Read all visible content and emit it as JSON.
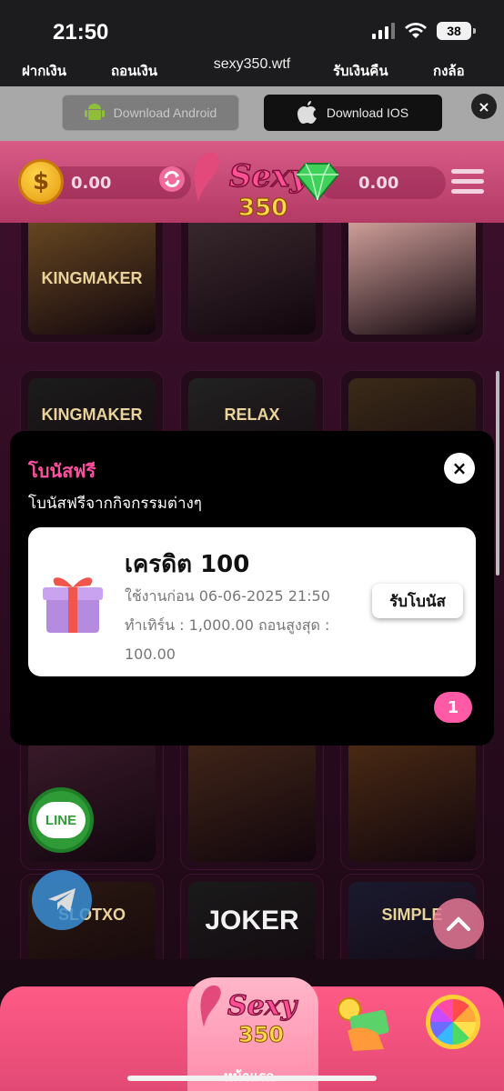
{
  "status_bar": {
    "time": "21:50",
    "battery": "38"
  },
  "browser": {
    "url": "sexy350.wtf"
  },
  "download_bar": {
    "android_label": "Download Android",
    "ios_label": "Download IOS",
    "close": "×"
  },
  "header": {
    "balance_left": "0.00",
    "balance_right": "0.00",
    "coin_symbol": "$",
    "logo_text": "Sexy",
    "logo_number": "350"
  },
  "games": [
    {
      "label": "KINGMAKER",
      "color": "#6b4a22"
    },
    {
      "label": "",
      "color": "#3a2a2f"
    },
    {
      "label": "",
      "color": "#d9a7a1"
    },
    {
      "label": "KINGMAKER",
      "color": "#1c1c1c"
    },
    {
      "label": "RELAX",
      "color": "#222"
    },
    {
      "label": "",
      "color": "#3a2a18"
    },
    {
      "label": "",
      "color": "#3a1a2a"
    },
    {
      "label": "",
      "color": "#402518"
    },
    {
      "label": "",
      "color": "#4a2a14"
    },
    {
      "label": "SLOTXO",
      "color": "#2a1810"
    },
    {
      "label": "JOKER",
      "color": "#1a1a1a"
    },
    {
      "label": "SIMPLE",
      "color": "#1a1a2e"
    }
  ],
  "modal": {
    "title": "โบนัสฟรี",
    "subtitle": "โบนัสฟรีจากกิจกรรมต่างๆ",
    "close": "×",
    "card": {
      "title": "เครดิต 100",
      "expiry": "ใช้งานก่อน 06-06-2025 21:50",
      "turnover": "ทำเทิร์น : 1,000.00  ถอนสูงสุด :",
      "max_withdraw": "100.00",
      "claim_label": "รับโบนัส"
    },
    "page_badge": "1"
  },
  "floating": {
    "line_label": "LINE"
  },
  "bottom_nav": {
    "deposit": "ฝากเงิน",
    "withdraw": "ถอนเงิน",
    "home": "หน้าแรก",
    "cashback": "รับเงินคืน",
    "wheel": "กงล้อ"
  },
  "colors": {
    "accent": "#ff4fa0",
    "header": "#c84672",
    "nav": "#ff5a86"
  }
}
